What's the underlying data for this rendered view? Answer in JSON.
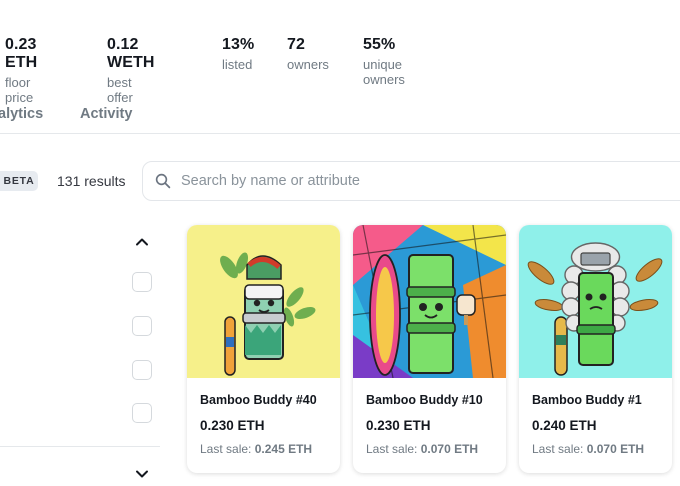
{
  "stats": [
    {
      "value": "0.23 ETH",
      "label": "floor price"
    },
    {
      "value": "0.12 WETH",
      "label": "best offer"
    },
    {
      "value": "13%",
      "label": "listed"
    },
    {
      "value": "72",
      "label": "owners"
    },
    {
      "value": "55%",
      "label": "unique owners"
    }
  ],
  "tabs": [
    {
      "label": "alytics"
    },
    {
      "label": "Activity"
    }
  ],
  "toolbar": {
    "beta_badge": "BETA",
    "results_text": "131 results",
    "search_placeholder": "Search by name or attribute"
  },
  "cards": [
    {
      "name": "Bamboo Buddy #40",
      "price": "0.230 ETH",
      "last_sale_label": "Last sale:",
      "last_sale_value": "0.245 ETH",
      "bg": "#f6f08a"
    },
    {
      "name": "Bamboo Buddy #10",
      "price": "0.230 ETH",
      "last_sale_label": "Last sale:",
      "last_sale_value": "0.070 ETH",
      "bg": "#2b9ad6"
    },
    {
      "name": "Bamboo Buddy #1",
      "price": "0.240 ETH",
      "last_sale_label": "Last sale:",
      "last_sale_value": "0.070 ETH",
      "bg": "#8ff0ea"
    }
  ]
}
